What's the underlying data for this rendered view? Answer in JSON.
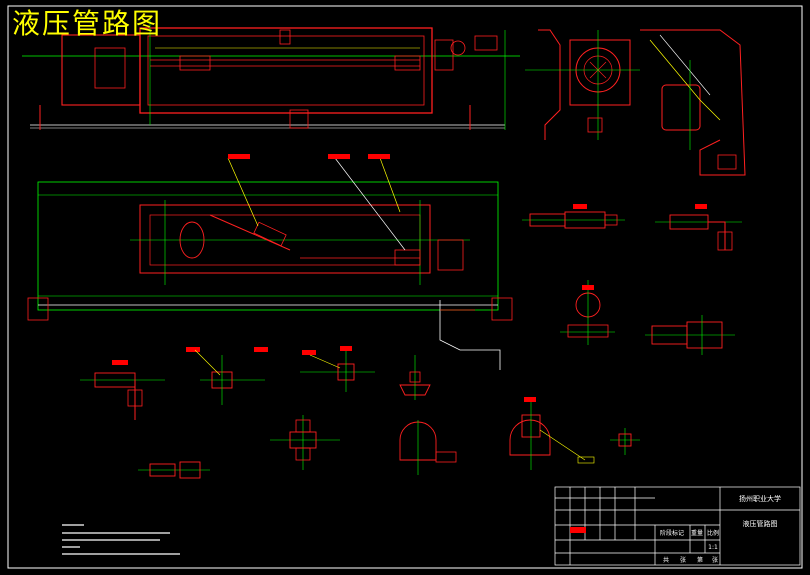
{
  "title": "液压管路图",
  "title_block": {
    "university": "扬州职业大学",
    "drawing_name": "液压管路图",
    "header_cells": [
      "阶段标记",
      "重量",
      "比例"
    ],
    "scale": "1:1",
    "sheet": [
      "共",
      "张",
      "第",
      "张"
    ]
  },
  "colors": {
    "background": "#000000",
    "part_outline": "#ff2020",
    "centerline": "#00ff00",
    "dimension": "#ffff00",
    "label_tag": "#ff0000",
    "title_text": "#ffff00",
    "frame": "#ffffff"
  }
}
